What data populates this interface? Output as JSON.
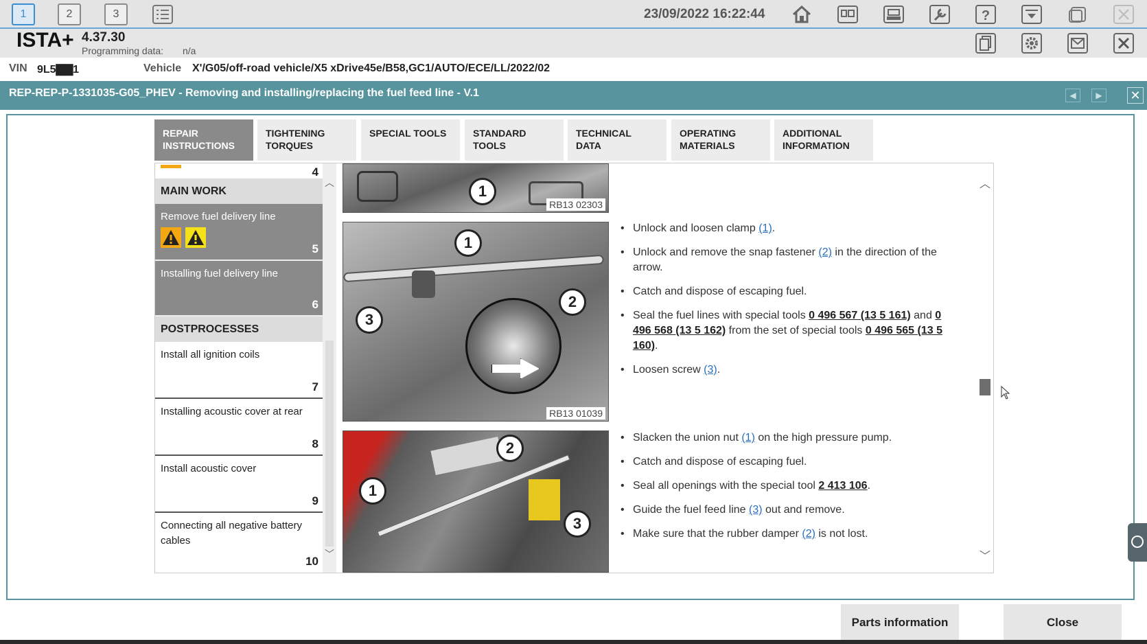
{
  "topbar": {
    "workspaces": [
      "1",
      "2",
      "3"
    ],
    "datetime": "23/09/2022 16:22:44"
  },
  "header": {
    "app_name": "ISTA+",
    "version": "4.37.30",
    "programming_label": "Programming data:",
    "programming_value": "n/a"
  },
  "vehicle": {
    "vin_label": "VIN",
    "vin_value": "9L5▇▇1",
    "vehicle_label": "Vehicle",
    "vehicle_value": "X'/G05/off-road vehicle/X5 xDrive45e/B58,GC1/AUTO/ECE/LL/2022/02"
  },
  "document": {
    "title": "REP-REP-P-1331035-G05_PHEV - Removing and installing/replacing the fuel feed line - V.1"
  },
  "tabs": [
    {
      "line1": "REPAIR",
      "line2": "INSTRUCTIONS"
    },
    {
      "line1": "TIGHTENING",
      "line2": "TORQUES"
    },
    {
      "line1": "SPECIAL TOOLS",
      "line2": ""
    },
    {
      "line1": "STANDARD",
      "line2": "TOOLS"
    },
    {
      "line1": "TECHNICAL",
      "line2": "DATA"
    },
    {
      "line1": "OPERATING",
      "line2": "MATERIALS"
    },
    {
      "line1": "ADDITIONAL",
      "line2": "INFORMATION"
    }
  ],
  "sidebar": {
    "prev_num": "4",
    "main_work": "MAIN WORK",
    "postprocesses": "POSTPROCESSES",
    "steps": [
      {
        "label": "Remove fuel delivery line",
        "num": "5"
      },
      {
        "label": "Installing fuel delivery line",
        "num": "6"
      },
      {
        "label": "Install all ignition coils",
        "num": "7"
      },
      {
        "label": "Installing acoustic cover at rear",
        "num": "8"
      },
      {
        "label": "Install acoustic cover",
        "num": "9"
      },
      {
        "label": "Connecting all negative battery cables",
        "num": "10"
      }
    ]
  },
  "images": {
    "img1_code": "RB13 02303",
    "img2_code": "RB13 01039",
    "callouts": [
      "1",
      "2",
      "3"
    ]
  },
  "instructions": {
    "block1": {
      "i1_pre": "Unlock and loosen clamp ",
      "i1_ref": "(1)",
      "i1_post": ".",
      "i2_pre": "Unlock and remove the snap fastener ",
      "i2_ref": "(2)",
      "i2_post": " in the direction of the arrow.",
      "i3": "Catch and dispose of escaping fuel.",
      "i4_pre": "Seal the fuel lines with special tools ",
      "i4_t1": "0 496 567 (13 5 161)",
      "i4_mid": " and ",
      "i4_t2": "0 496 568 (13 5 162)",
      "i4_mid2": " from the set of special tools ",
      "i4_t3": "0 496 565 (13 5 160)",
      "i4_post": ".",
      "i5_pre": "Loosen screw ",
      "i5_ref": "(3)",
      "i5_post": "."
    },
    "block2": {
      "j1_pre": "Slacken the union nut ",
      "j1_ref": "(1)",
      "j1_post": " on the high pressure pump.",
      "j2": "Catch and dispose of escaping fuel.",
      "j3_pre": "Seal all openings with the special tool ",
      "j3_tool": "2 413 106",
      "j3_post": ".",
      "j4_pre": "Guide the fuel feed line ",
      "j4_ref": "(3)",
      "j4_post": " out and remove.",
      "j5_pre": "Make sure that the rubber damper ",
      "j5_ref": "(2)",
      "j5_post": " is not lost."
    }
  },
  "footer": {
    "parts_button": "Parts information",
    "close_button": "Close"
  },
  "colors": {
    "accent": "#57949d",
    "link": "#2a6fbf",
    "warning": "#f3a712"
  }
}
